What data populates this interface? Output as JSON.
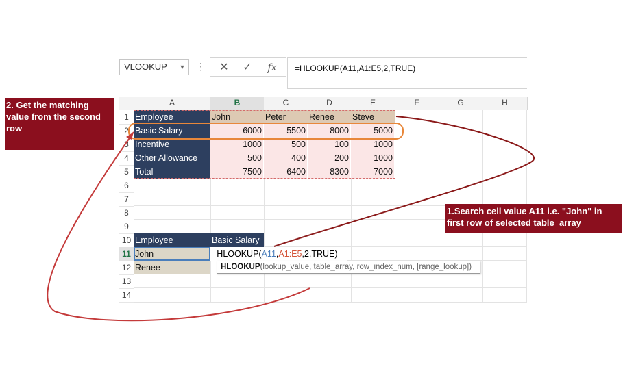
{
  "formula_bar": {
    "name_box": "VLOOKUP",
    "cancel_icon": "✕",
    "enter_icon": "✓",
    "fx_icon": "fx",
    "formula": "=HLOOKUP(A11,A1:E5,2,TRUE)"
  },
  "columns": [
    "A",
    "B",
    "C",
    "D",
    "E",
    "F",
    "G",
    "H"
  ],
  "rows": [
    "1",
    "2",
    "3",
    "4",
    "5",
    "6",
    "7",
    "8",
    "9",
    "10",
    "11",
    "12",
    "13",
    "14"
  ],
  "table": {
    "header": [
      "Employee",
      "John",
      "Peter",
      "Renee",
      "Steve"
    ],
    "rows": [
      {
        "label": "Basic Salary",
        "values": [
          "6000",
          "5500",
          "8000",
          "5000"
        ]
      },
      {
        "label": "Incentive",
        "values": [
          "1000",
          "500",
          "100",
          "1000"
        ]
      },
      {
        "label": "Other Allowance",
        "values": [
          "500",
          "400",
          "200",
          "1000"
        ]
      },
      {
        "label": "Total",
        "values": [
          "7500",
          "6400",
          "8300",
          "7000"
        ]
      }
    ]
  },
  "lookup_table": {
    "header_a": "Employee",
    "header_b": "Basic Salary",
    "a11": "John",
    "a12": "Renee",
    "b11_formula": {
      "p1": "=HLOOKUP(",
      "ref1": "A11",
      "c1": ",",
      "ref2": "A1:E5",
      "rest": ",2,TRUE)"
    }
  },
  "tooltip": {
    "func": "HLOOKUP",
    "args": "(lookup_value, table_array, row_index_num, [range_lookup])"
  },
  "callouts": {
    "left": "2. Get the matching value from the second row",
    "right": "1.Search cell value A11 i.e. \"John\" in first row of selected table_array"
  },
  "colors": {
    "dark_blue": "#2d3f5f",
    "callout_red": "#8b0f1e",
    "highlight_orange": "#e8873a",
    "excel_green": "#217346"
  }
}
